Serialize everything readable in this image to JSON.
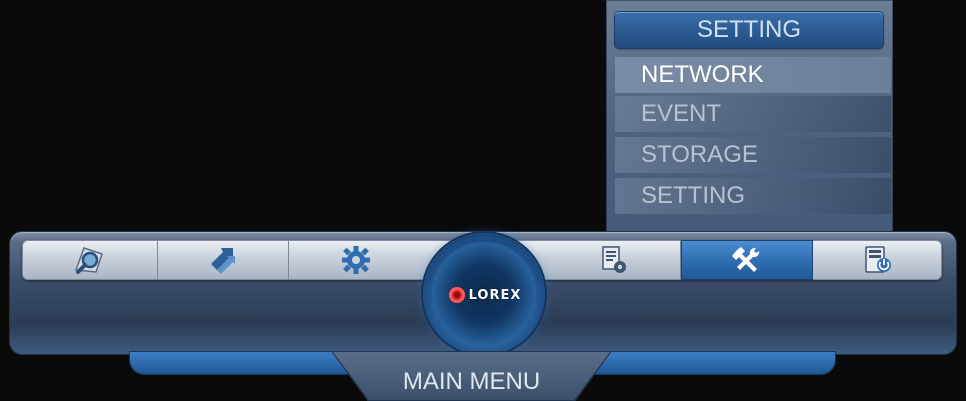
{
  "dropdown": {
    "header": "SETTING",
    "items": [
      {
        "label": "NETWORK",
        "state": "highlighted"
      },
      {
        "label": "EVENT",
        "state": "normal"
      },
      {
        "label": "STORAGE",
        "state": "normal"
      },
      {
        "label": "SETTING",
        "state": "normal"
      }
    ]
  },
  "toolbar": {
    "buttons": [
      {
        "icon": "search-icon"
      },
      {
        "icon": "backup-arrows-icon"
      },
      {
        "icon": "gear-icon"
      },
      {
        "icon": "info-document-gear-icon"
      },
      {
        "icon": "tools-icon",
        "selected": true
      },
      {
        "icon": "shutdown-icon"
      }
    ],
    "logo_text": "LOREX"
  },
  "main_tab": {
    "label": "MAIN MENU"
  },
  "colors": {
    "accent": "#2f6fb1",
    "background": "#0a0a0a",
    "logo_red": "#d7201f"
  }
}
